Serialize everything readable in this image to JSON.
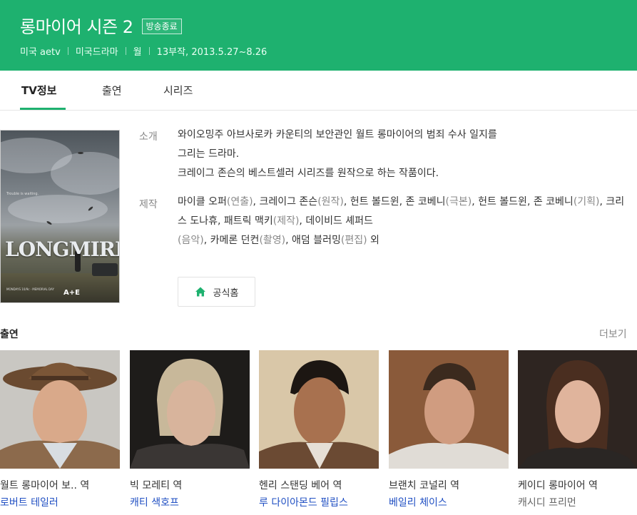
{
  "header": {
    "title": "롱마이어 시즌 2",
    "status_badge": "방송종료",
    "meta": [
      "미국 aetv",
      "미국드라마",
      "월",
      "13부작, 2013.5.27~8.26"
    ]
  },
  "tabs": [
    {
      "label": "TV정보",
      "active": true
    },
    {
      "label": "출연",
      "active": false
    },
    {
      "label": "시리즈",
      "active": false
    }
  ],
  "poster": {
    "title_text": "LONGMIRE",
    "tagline": "Trouble is waiting.",
    "network": "A+E",
    "premiere": "MONDAYS 10/9c · MEMORIAL DAY"
  },
  "info": {
    "intro_label": "소개",
    "intro_lines": [
      "와이오밍주 아브사로카 카운티의 보안관인 월트 롱마이어의 범죄 수사 일지를",
      "그리는 드라마.",
      "크레이그 존슨의 베스트셀러 시리즈를 원작으로 하는 작품이다."
    ],
    "production_label": "제작",
    "production": {
      "p1": "마이클 오퍼",
      "r1": "(연출)",
      "p2": ", 크레이그 존슨",
      "r2": "(원작)",
      "p3": ", 헌트 볼드윈, 존 코베니",
      "r3": "(극본)",
      "p4": ", 헌트 볼드윈, 존 코베니",
      "r4": "(기획)",
      "p5": ", 크리스 도나휴, 패트릭 맥키",
      "r5": "(제작)",
      "p6": ", 데이비드 셰퍼드",
      "r6": "(음악)",
      "p7": ", 카메론 던컨",
      "r7": "(촬영)",
      "p8": ", 애덤 블러밍",
      "r8": "(편집)",
      "p9": " 외"
    },
    "homepage_label": "공식홈"
  },
  "cast": {
    "title": "출연",
    "more_label": "더보기",
    "members": [
      {
        "role": "월트 롱마이어 보.. 역",
        "name": "로버트 테일러",
        "linked": true
      },
      {
        "role": "빅 모레티 역",
        "name": "캐티 색호프",
        "linked": true
      },
      {
        "role": "헨리 스탠딩 베어 역",
        "name": "루 다이아몬드 필립스",
        "linked": true
      },
      {
        "role": "브랜치 코널리 역",
        "name": "베일리 체이스",
        "linked": true
      },
      {
        "role": "케이디 롱마이어 역",
        "name": "캐시디 프리먼",
        "linked": false
      }
    ]
  },
  "colors": {
    "header_bg": "#1eb16f",
    "link": "#2150c3",
    "accent": "#1eb16f"
  },
  "icons": {
    "homepage": "home-icon"
  }
}
